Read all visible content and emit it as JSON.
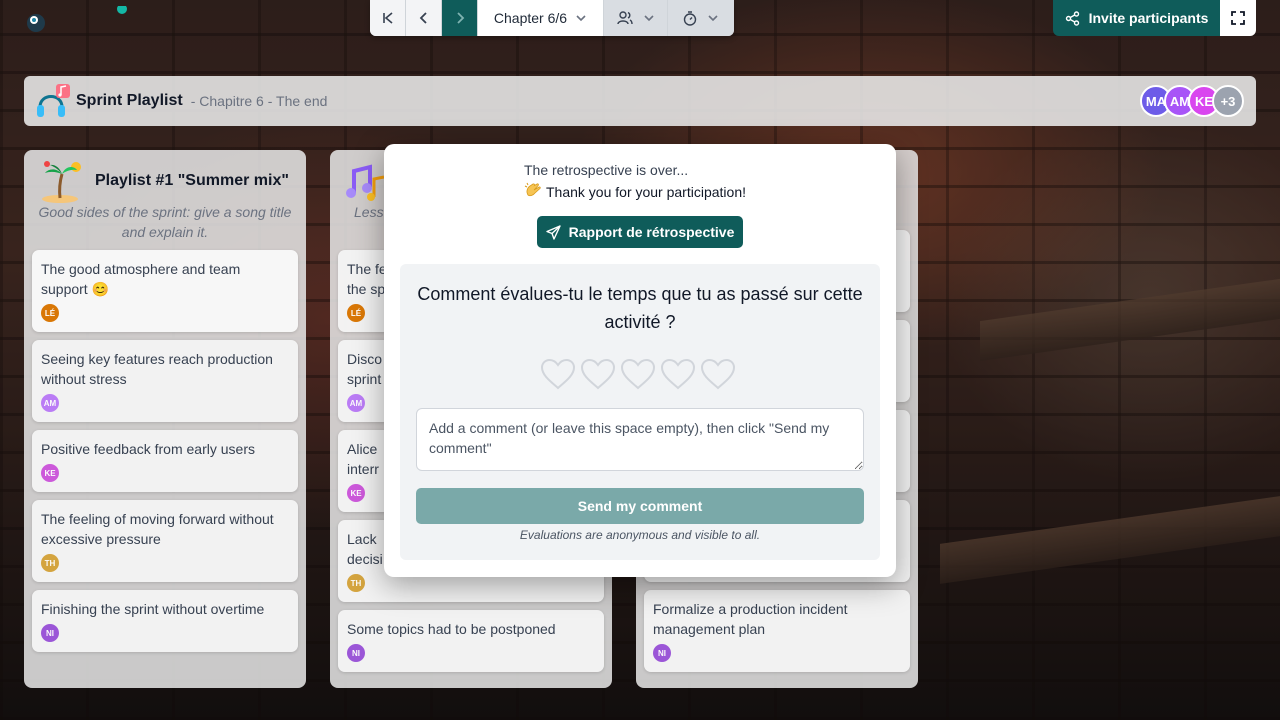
{
  "toolbar": {
    "chapter_label": "Chapter 6/6",
    "invite_label": "Invite participants"
  },
  "header": {
    "title": "Sprint Playlist",
    "subtitle": "- Chapitre 6 - The end",
    "avatars": [
      {
        "initials": "MA",
        "color": "#6d5ce8"
      },
      {
        "initials": "AM",
        "color": "#a855f7"
      },
      {
        "initials": "KE",
        "color": "#d946ef"
      },
      {
        "initials": "+3",
        "color": "#9ca3af"
      }
    ]
  },
  "columns": [
    {
      "title": "Playlist #1 \"Summer mix\"",
      "description": "Good sides of the sprint: give a song title and explain it.",
      "cards": [
        {
          "text": "The good atmosphere and team support 😊",
          "author": "LÉ",
          "color": "#d97706"
        },
        {
          "text": "Seeing key features reach production without stress",
          "author": "AM",
          "color": "#a855f7"
        },
        {
          "text": "Positive feedback from early users",
          "author": "KE",
          "color": "#c026d3"
        },
        {
          "text": "The feeling of moving forward without excessive pressure",
          "author": "TH",
          "color": "#ca8a04"
        },
        {
          "text": "Finishing the sprint without overtime",
          "author": "NI",
          "color": "#7e22ce"
        }
      ]
    },
    {
      "title": "",
      "description": "Less",
      "cards": [
        {
          "text": "The fe the sp",
          "author": "LÉ",
          "color": "#d97706"
        },
        {
          "text": "Disco sprint",
          "author": "AM",
          "color": "#a855f7"
        },
        {
          "text": "Alice interr",
          "author": "KE",
          "color": "#c026d3"
        },
        {
          "text": "Lack decisi",
          "author": "TH",
          "color": "#ca8a04"
        },
        {
          "text": "Some topics had to be postponed",
          "author": "NI",
          "color": "#7e22ce"
        }
      ]
    },
    {
      "title": "",
      "description": "",
      "cards": [
        {
          "text": "Formalize a production incident management plan",
          "author": "NI",
          "color": "#7e22ce"
        }
      ]
    }
  ],
  "modal": {
    "over_line1": "The retrospective is over...",
    "over_line2": "Thank you for your participation!",
    "report_label": "Rapport de rétrospective",
    "question": "Comment évalues-tu le temps que tu as passé sur cette activité ?",
    "rating_max": 5,
    "rating_value": 0,
    "comment_placeholder": "Add a comment (or leave this space empty), then click \"Send my comment\"",
    "send_label": "Send my comment",
    "anon_note": "Evaluations are anonymous and visible to all."
  },
  "colors": {
    "primary": "#0f5c5a",
    "send_disabled": "#7aa9a9"
  }
}
